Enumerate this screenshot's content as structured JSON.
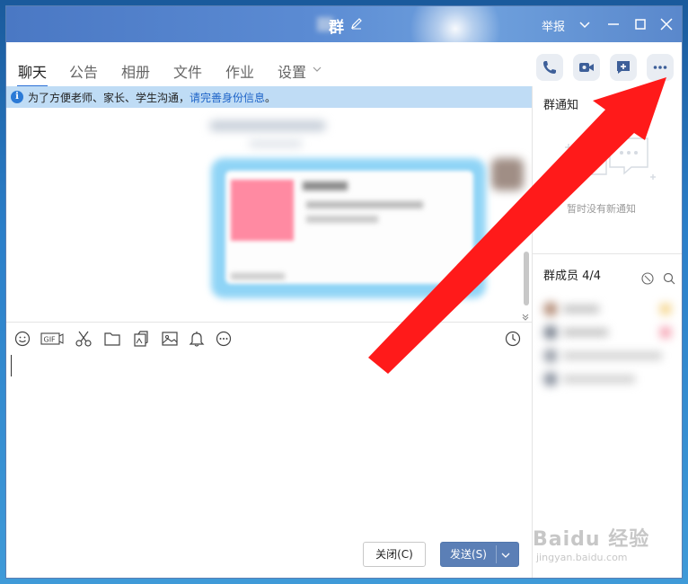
{
  "window": {
    "title": "群",
    "report_label": "举报"
  },
  "tabs": [
    {
      "label": "聊天",
      "active": true
    },
    {
      "label": "公告"
    },
    {
      "label": "相册"
    },
    {
      "label": "文件"
    },
    {
      "label": "作业"
    },
    {
      "label": "设置"
    }
  ],
  "header_actions": [
    "phone-icon",
    "video-icon",
    "add-chat-icon",
    "more-icon"
  ],
  "notice": {
    "text": "为了方便老师、家长、学生沟通，",
    "link": "请完善身份信息",
    "end": "。"
  },
  "toolbar_icons": [
    "emoji-icon",
    "gif-icon",
    "scissors-icon",
    "folder-icon",
    "sticker-icon",
    "image-icon",
    "bell-icon",
    "more-icon",
    "history-icon"
  ],
  "buttons": {
    "close": "关闭(C)",
    "send": "发送(S)"
  },
  "right_panel": {
    "notice_title": "群通知",
    "empty_text": "暂时没有新通知",
    "members_title": "群成员 4/4"
  },
  "watermark": {
    "brand": "Baidu 经验",
    "url": "jingyan.baidu.com"
  },
  "colors": {
    "accent": "#2b6fd6",
    "title_bar": "#5b8bd3",
    "notice_bg": "#bfdcf5",
    "send_button": "#5b7fb6",
    "arrow": "#ff1a1a"
  }
}
